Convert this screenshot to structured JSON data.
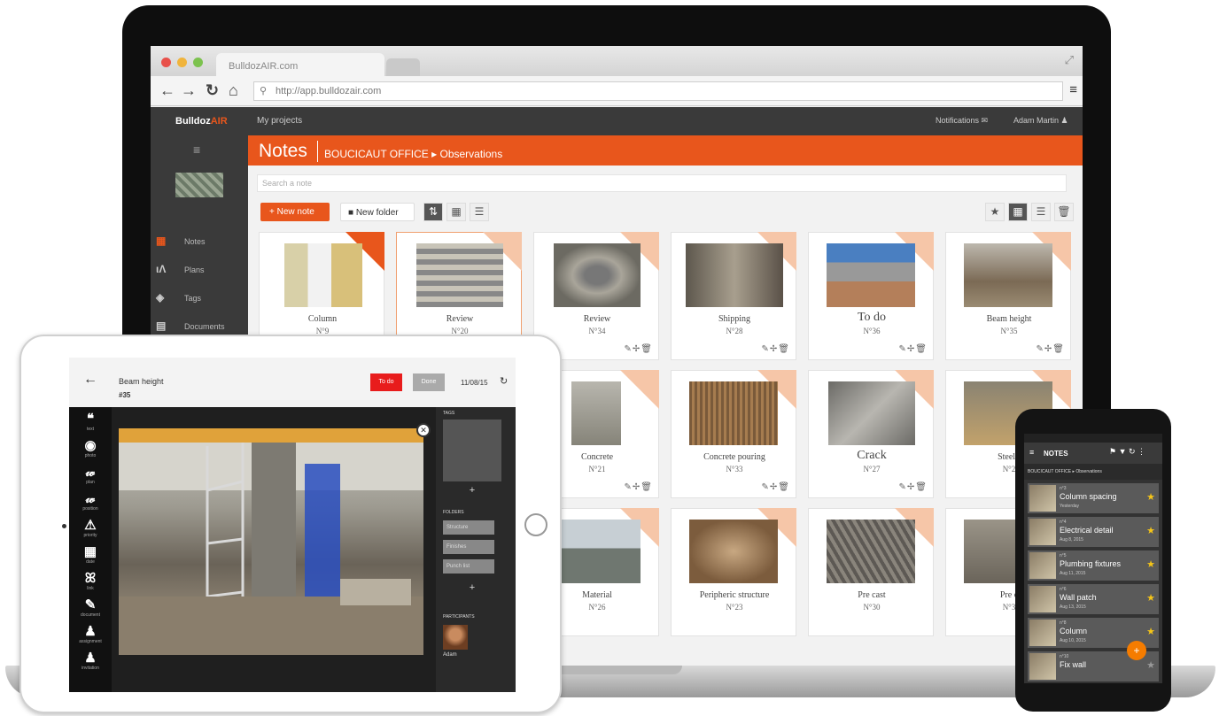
{
  "browser": {
    "tab_title": "BulldozAIR.com",
    "url": "http://app.bulldozair.com",
    "back": "←",
    "forward": "→",
    "reload": "↻",
    "home": "⌂",
    "menu": "≡"
  },
  "app": {
    "brand_prefix": "Bulldoz",
    "brand_suffix": "AIR",
    "my_projects": "My projects",
    "notifications": "Notifications ✉",
    "user": "Adam Martin ♟"
  },
  "sidebar": {
    "items": [
      {
        "label": "Notes",
        "icon": "notes-icon"
      },
      {
        "label": "Plans",
        "icon": "plans-icon"
      },
      {
        "label": "Tags",
        "icon": "tags-icon"
      },
      {
        "label": "Documents",
        "icon": "documents-icon"
      }
    ]
  },
  "header": {
    "title": "Notes",
    "breadcrumb_project": "BOUCICAUT OFFICE ▸",
    "breadcrumb_folder": "Observations"
  },
  "toolbar": {
    "search_placeholder": "Search a note",
    "new_note": "+ New note",
    "new_folder": "■ New folder"
  },
  "notes": [
    {
      "title": "Column",
      "number": "N°9"
    },
    {
      "title": "Review",
      "number": "N°20"
    },
    {
      "title": "Review",
      "number": "N°34"
    },
    {
      "title": "Shipping",
      "number": "N°28"
    },
    {
      "title": "To do",
      "number": "N°36"
    },
    {
      "title": "Beam height",
      "number": "N°35"
    },
    {
      "title": "Concrete",
      "number": "N°21"
    },
    {
      "title": "Concrete pouring",
      "number": "N°33"
    },
    {
      "title": "Crack",
      "number": "N°27"
    },
    {
      "title": "Steel r",
      "number": "N°2"
    },
    {
      "title": "Material",
      "number": "N°26"
    },
    {
      "title": "Peripheric structure",
      "number": "N°23"
    },
    {
      "title": "Pre cast",
      "number": "N°30"
    },
    {
      "title": "Pre c",
      "number": "N°3"
    }
  ],
  "tablet": {
    "title": "Beam height",
    "number": "#35",
    "todo": "To do",
    "done": "Done",
    "date": "11/08/15",
    "tools": [
      {
        "icon": "❝",
        "label": "text"
      },
      {
        "icon": "◉",
        "label": "photo"
      },
      {
        "icon": "𝓌",
        "label": "plan"
      },
      {
        "icon": "𝓌",
        "label": "position"
      },
      {
        "icon": "⚠",
        "label": "priority"
      },
      {
        "icon": "▦",
        "label": "date"
      },
      {
        "icon": "ꕤ",
        "label": "link"
      },
      {
        "icon": "✎",
        "label": "document"
      },
      {
        "icon": "♟",
        "label": "assignment"
      },
      {
        "icon": "♟",
        "label": "invitation"
      }
    ],
    "tags_label": "TAGS",
    "folders_label": "FOLDERS",
    "folders": [
      "Structure",
      "Finishes",
      "Punch list"
    ],
    "participants_label": "PARTICIPANTS",
    "participant": "Adam"
  },
  "phone": {
    "title": "NOTES",
    "breadcrumb_project": "BOUCICAUT OFFICE",
    "breadcrumb_folder": "Observations",
    "items": [
      {
        "number": "n°3",
        "name": "Column spacing",
        "date": "Yesterday",
        "starred": true
      },
      {
        "number": "n°4",
        "name": "Electrical detail",
        "date": "Aug 8, 2015",
        "starred": true
      },
      {
        "number": "n°5",
        "name": "Plumbing fixtures",
        "date": "Aug 11, 2015",
        "starred": true
      },
      {
        "number": "n°6",
        "name": "Wall patch",
        "date": "Aug 13, 2015",
        "starred": true
      },
      {
        "number": "n°8",
        "name": "Column",
        "date": "Aug 10, 2015",
        "starred": true
      },
      {
        "number": "n°10",
        "name": "Fix wall",
        "date": "",
        "starred": false
      }
    ],
    "fab": "+"
  },
  "colors": {
    "accent": "#e8561c",
    "dark": "#3a3a3a",
    "star": "#f5c518"
  }
}
